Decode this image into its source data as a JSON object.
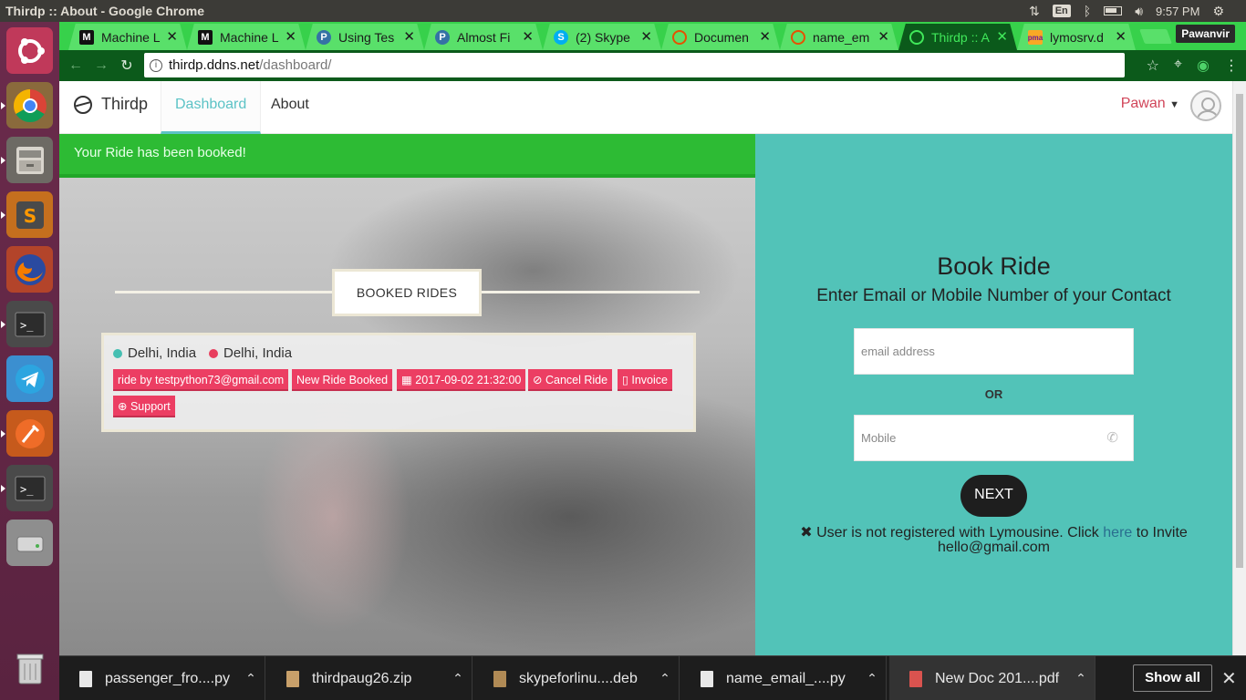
{
  "os": {
    "window_title": "Thirdp :: About - Google Chrome",
    "language": "En",
    "time": "9:57 PM"
  },
  "browser": {
    "profile_name": "Pawanvir",
    "tabs": [
      {
        "label": "Machine L",
        "favicon": "M",
        "active": false
      },
      {
        "label": "Machine L",
        "favicon": "M",
        "active": false
      },
      {
        "label": "Using Tes",
        "favicon": "P",
        "active": false
      },
      {
        "label": "Almost Fi",
        "favicon": "P",
        "active": false
      },
      {
        "label": "(2) Skype",
        "favicon": "S",
        "active": false
      },
      {
        "label": "Documen",
        "favicon": "",
        "active": false
      },
      {
        "label": "name_em",
        "favicon": "",
        "active": false
      },
      {
        "label": "Thirdp :: A",
        "favicon": "",
        "active": true
      },
      {
        "label": "lymosrv.d",
        "favicon": "",
        "active": false
      }
    ],
    "url_host": "thirdp.ddns.net",
    "url_path": "/dashboard/"
  },
  "site": {
    "brand": "Thirdp",
    "nav": {
      "dashboard": "Dashboard",
      "about": "About"
    },
    "user_name": "Pawan",
    "alert": "Your Ride has been booked!",
    "section_title": "BOOKED RIDES",
    "ride": {
      "from": "Delhi, India",
      "to": "Delhi, India",
      "from_color": "#45bfb2",
      "to_color": "#e83e5e",
      "rider": "ride by testpython73@gmail.com",
      "status": "New Ride Booked",
      "datetime": "2017-09-02 21:32:00",
      "cancel_label": "Cancel Ride",
      "invoice_label": "Invoice",
      "support_label": "Support"
    },
    "book": {
      "title": "Book Ride",
      "subtitle": "Enter Email or Mobile Number of your Contact",
      "email_placeholder": "email address",
      "or_label": "OR",
      "mobile_placeholder": "Mobile",
      "next_label": "NEXT",
      "invite_prefix": "User is not registered with Lymousine. Click",
      "invite_link": "here",
      "invite_suffix": "to Invite",
      "invite_email": "hello@gmail.com"
    }
  },
  "downloads": {
    "items": [
      {
        "name": "passenger_fro....py",
        "icon": "file-icon"
      },
      {
        "name": "thirdpaug26.zip",
        "icon": "archive-icon"
      },
      {
        "name": "skypeforlinu....deb",
        "icon": "package-icon"
      },
      {
        "name": "name_email_....py",
        "icon": "file-icon"
      },
      {
        "name": "New Doc 201....pdf",
        "icon": "pdf-icon"
      }
    ],
    "show_all": "Show all"
  },
  "colors": {
    "tab_strip": "#37d14b",
    "toolbar": "#0c5a1b",
    "alert_green": "#2dbb34",
    "teal": "#52c3b8",
    "tag_pink": "#ec3e63"
  }
}
